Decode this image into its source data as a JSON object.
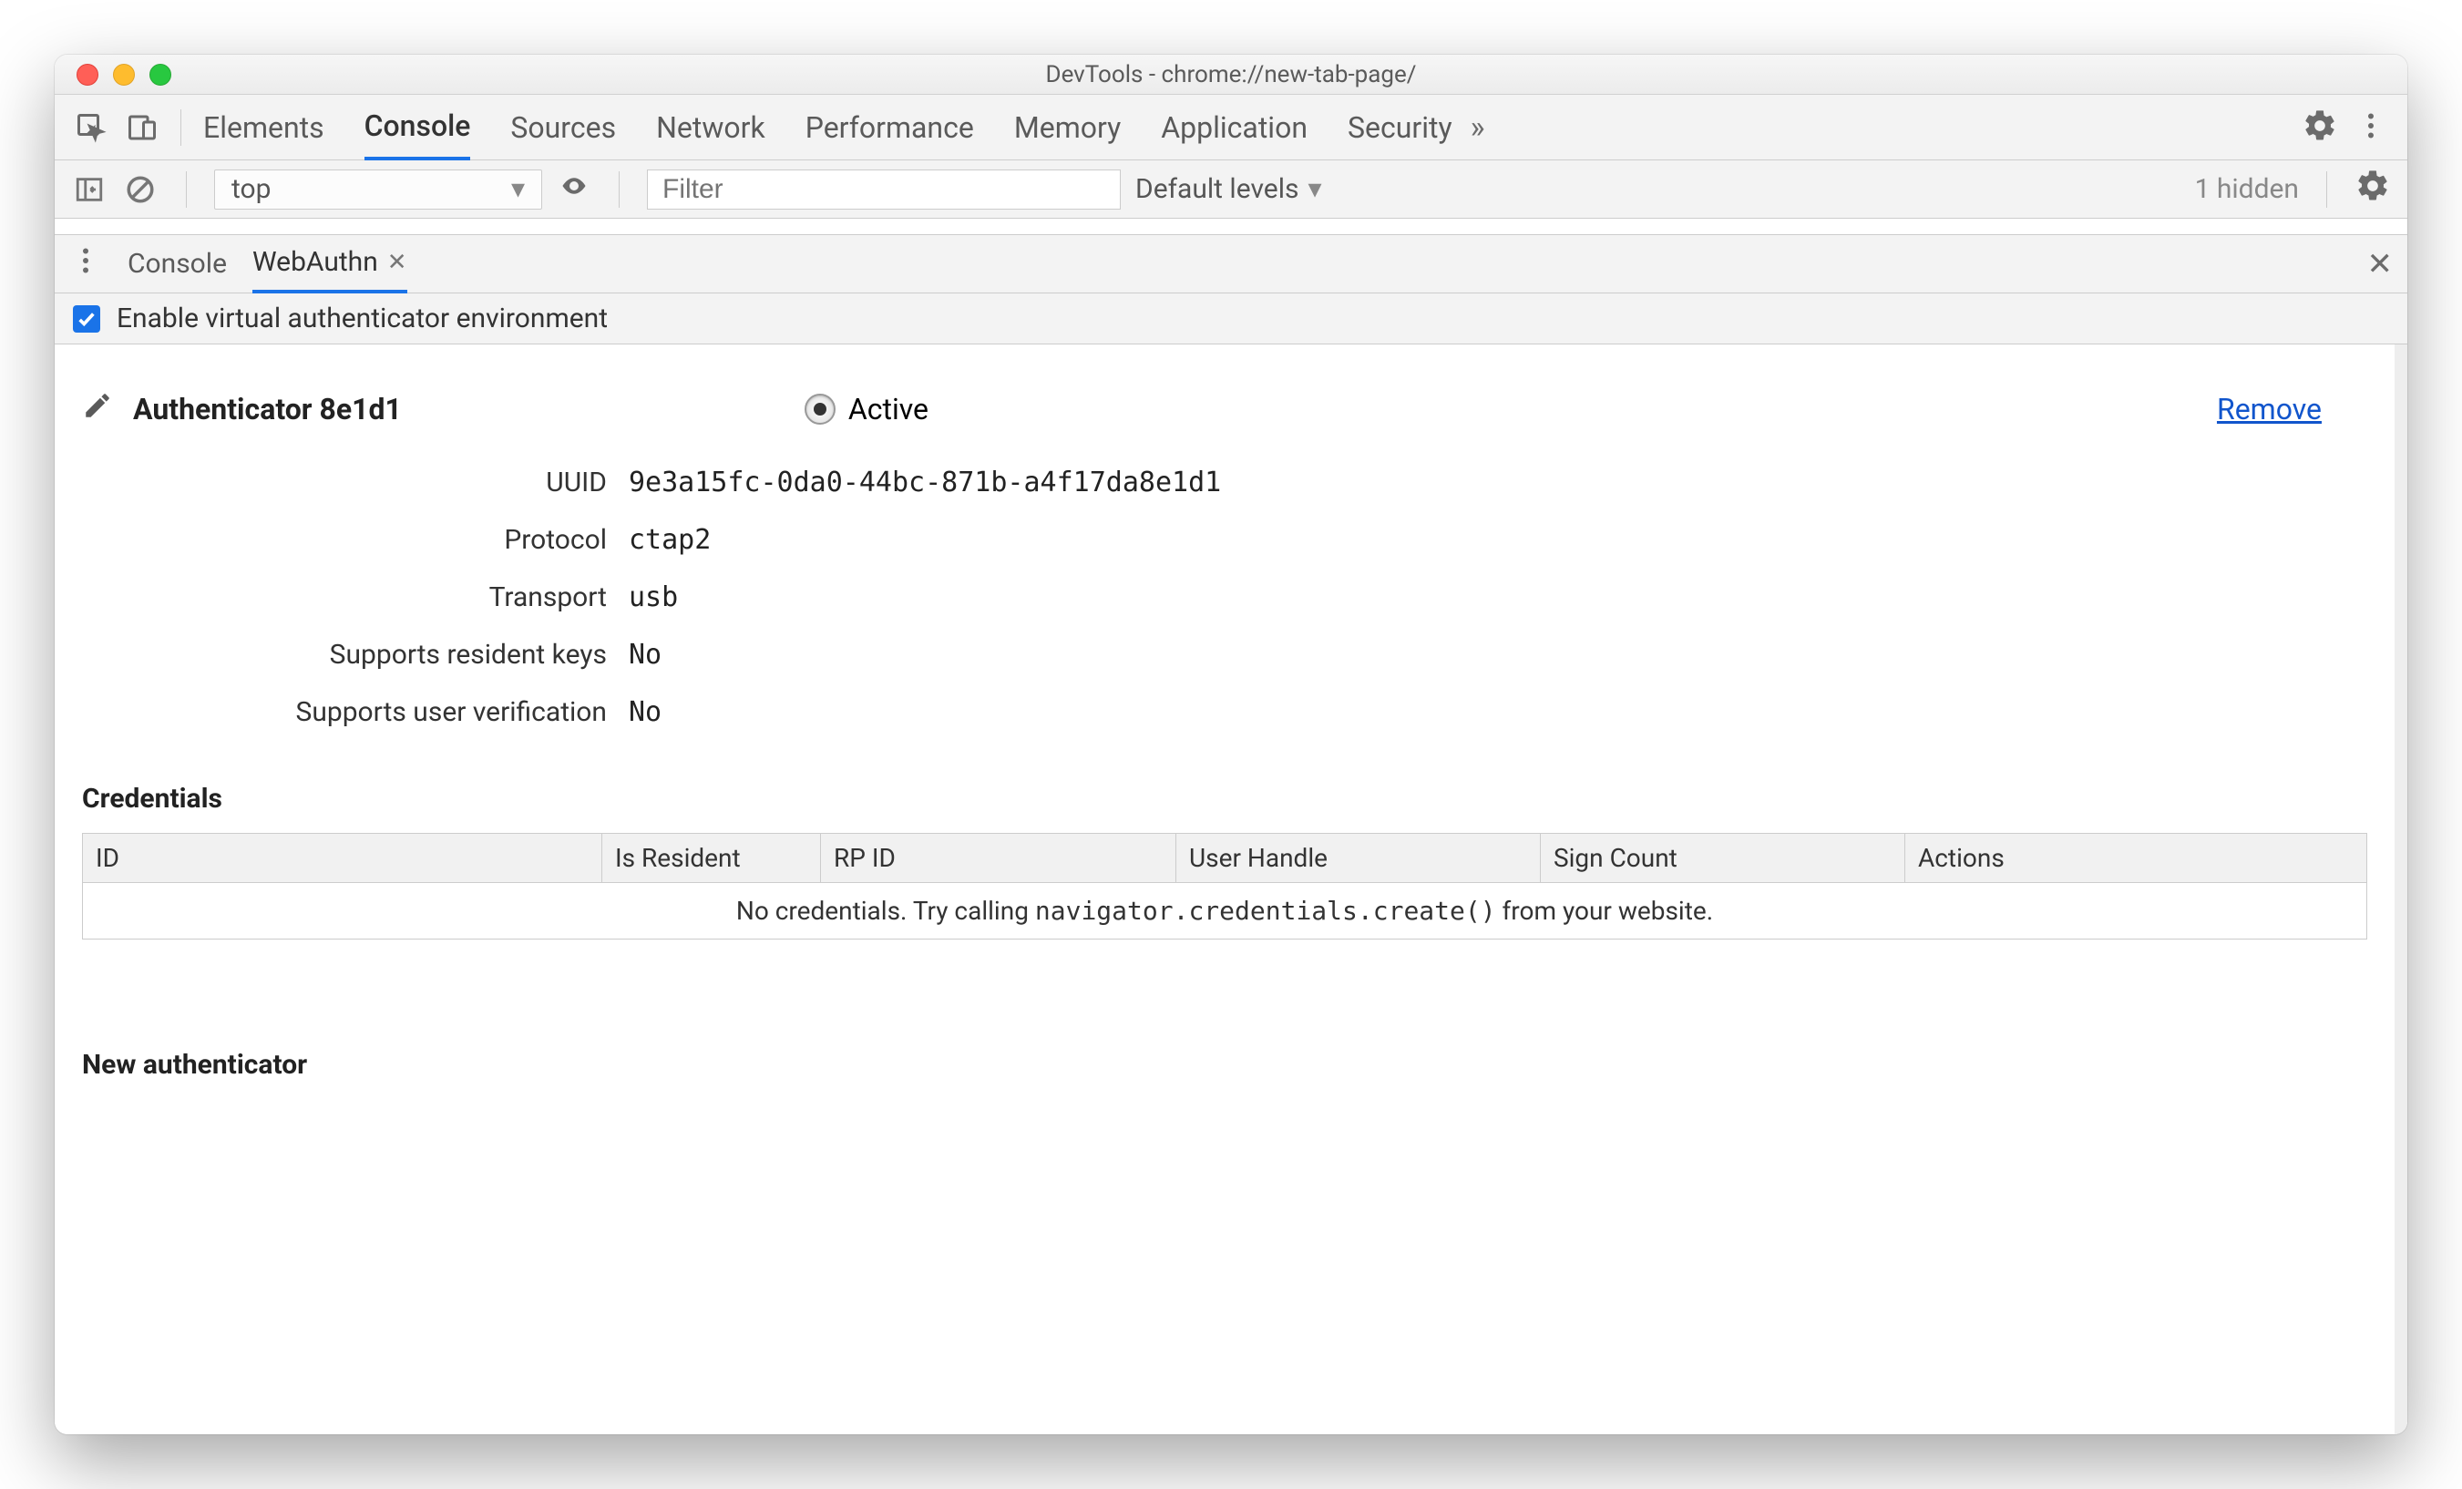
{
  "window": {
    "title": "DevTools - chrome://new-tab-page/"
  },
  "mainTabs": {
    "items": [
      "Elements",
      "Console",
      "Sources",
      "Network",
      "Performance",
      "Memory",
      "Application",
      "Security"
    ],
    "activeIndex": 1
  },
  "consoleBar": {
    "context": "top",
    "filterPlaceholder": "Filter",
    "levels": "Default levels",
    "hidden": "1 hidden"
  },
  "drawer": {
    "tabs": [
      {
        "label": "Console",
        "closable": false
      },
      {
        "label": "WebAuthn",
        "closable": true
      }
    ],
    "activeIndex": 1
  },
  "enable": {
    "label": "Enable virtual authenticator environment",
    "checked": true
  },
  "authenticator": {
    "name": "Authenticator 8e1d1",
    "activeLabel": "Active",
    "removeLabel": "Remove",
    "props": {
      "uuid_label": "UUID",
      "uuid": "9e3a15fc-0da0-44bc-871b-a4f17da8e1d1",
      "protocol_label": "Protocol",
      "protocol": "ctap2",
      "transport_label": "Transport",
      "transport": "usb",
      "resident_label": "Supports resident keys",
      "resident": "No",
      "userver_label": "Supports user verification",
      "userver": "No"
    }
  },
  "credentials": {
    "heading": "Credentials",
    "columns": [
      "ID",
      "Is Resident",
      "RP ID",
      "User Handle",
      "Sign Count",
      "Actions"
    ],
    "empty_pre": "No credentials. Try calling ",
    "empty_code": "navigator.credentials.create()",
    "empty_post": " from your website."
  },
  "newAuth": {
    "heading": "New authenticator"
  }
}
